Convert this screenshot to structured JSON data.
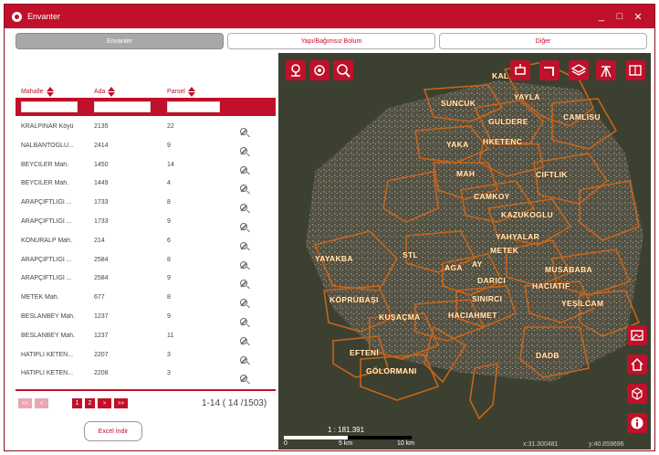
{
  "window": {
    "title": "Envanter",
    "min": "_",
    "max": "□",
    "close": "✕"
  },
  "tabs": [
    "Envanter",
    "Yapı/Bağımsız Bolum",
    "Diğer"
  ],
  "table": {
    "headers": [
      "Mahalle",
      "Ada",
      "Parsel"
    ],
    "rows": [
      [
        "KRALPINAR Köyü",
        "2135",
        "22"
      ],
      [
        "NALBANTOĞLU...",
        "2414",
        "9"
      ],
      [
        "BEYCİLER Mah.",
        "1450",
        "14"
      ],
      [
        "BEYCİLER Mah.",
        "1449",
        "4"
      ],
      [
        "ARAPÇİFTLİĞİ ...",
        "1733",
        "8"
      ],
      [
        "ARAPÇİFTLİĞİ ...",
        "1733",
        "9"
      ],
      [
        "KONURALP Mah.",
        "214",
        "6"
      ],
      [
        "ARAPÇİFTLİĞİ ...",
        "2584",
        "8"
      ],
      [
        "ARAPÇİFTLİĞİ ...",
        "2584",
        "9"
      ],
      [
        "METEK Mah.",
        "677",
        "8"
      ],
      [
        "BESLANBEY Mah.",
        "1237",
        "9"
      ],
      [
        "BESLANBEY Mah.",
        "1237",
        "11"
      ],
      [
        "HATİPLİ KETEN...",
        "2207",
        "3"
      ],
      [
        "HATİPLİ KETEN...",
        "2208",
        "3"
      ]
    ]
  },
  "pager": {
    "first": "<<",
    "prev": "<",
    "pages": [
      "1",
      "2"
    ],
    "next": ">",
    "last": ">>",
    "summary": "1-14 ( 14 /1503)"
  },
  "excel_button": "Excel İndir",
  "map": {
    "labels": [
      "KAL",
      "YAYLA",
      "SUNCUK",
      "GULDERE",
      "CAMLISU",
      "YAKA",
      "HKETENC",
      "MAH",
      "CIFTLIK",
      "CAMKOY",
      "KAZUKOGLU",
      "YAHYALAR",
      "METEK",
      "STL",
      "YAYAKBA",
      "AGA",
      "AY",
      "MUSABABA",
      "DARICI",
      "HACIATIF",
      "KÖPRÜBAŞI",
      "SINIRCI",
      "YEŞİLCAM",
      "HACIAHMET",
      "KUŞAÇMA",
      "EFTENİ",
      "DADB",
      "GÖLORMANI"
    ],
    "scale_ratio": "1 : 181.391",
    "scale_ticks": [
      "0",
      "5 km",
      "10 km"
    ],
    "coord_x": "x:31.300481",
    "coord_y": "y:40.859696"
  },
  "colors": {
    "accent": "#c0102a",
    "boundary": "#c8641a"
  }
}
